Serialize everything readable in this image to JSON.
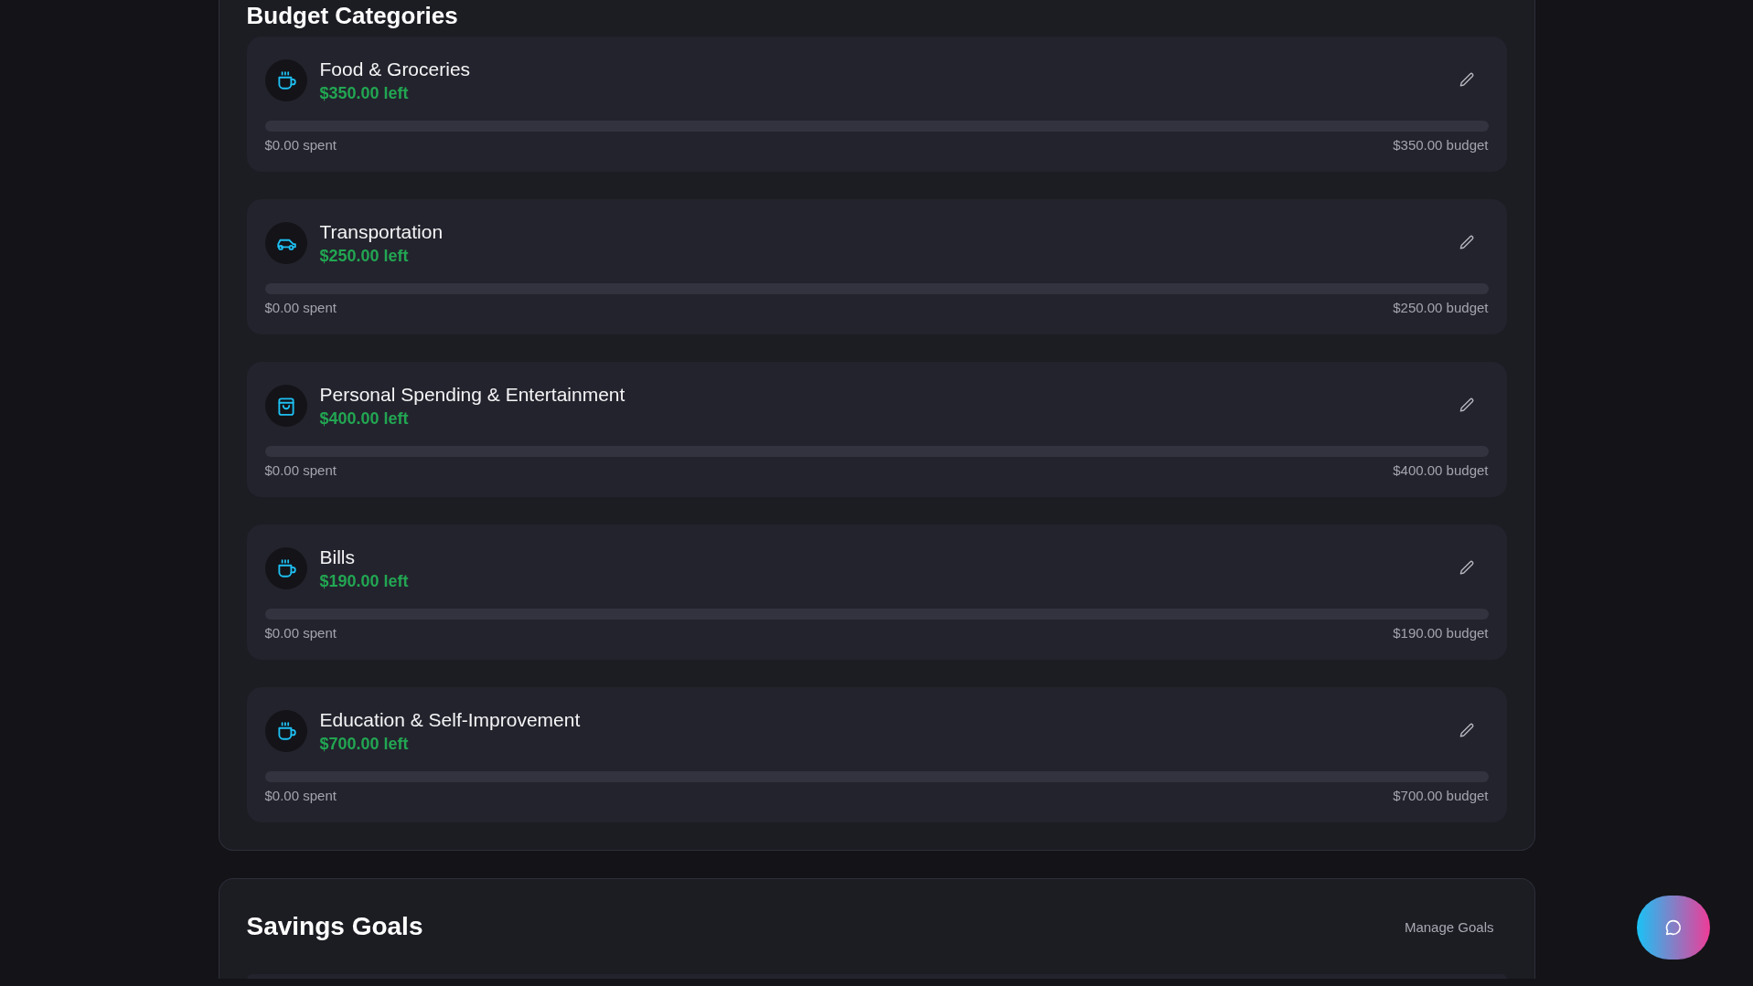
{
  "budget_panel": {
    "title": "Budget Categories",
    "categories": [
      {
        "name": "Food & Groceries",
        "kind": "cup",
        "remaining": "$350.00 left",
        "level": 0,
        "spent": "$0.00 spent",
        "budget": "$350.00 budget"
      },
      {
        "name": "Transportation",
        "kind": "car",
        "remaining": "$250.00 left",
        "level": 0,
        "spent": "$0.00 spent",
        "budget": "$250.00 budget"
      },
      {
        "name": "Personal Spending & Entertainment",
        "kind": "bag",
        "remaining": "$400.00 left",
        "level": 0,
        "spent": "$0.00 spent",
        "budget": "$400.00 budget"
      },
      {
        "name": "Bills",
        "kind": "cup",
        "remaining": "$190.00 left",
        "level": 0,
        "spent": "$0.00 spent",
        "budget": "$190.00 budget"
      },
      {
        "name": "Education & Self-Improvement",
        "kind": "cup",
        "remaining": "$700.00 left",
        "level": 0,
        "spent": "$0.00 spent",
        "budget": "$700.00 budget"
      }
    ]
  },
  "savings_panel": {
    "title": "Savings Goals",
    "action": "Manage Goals"
  }
}
